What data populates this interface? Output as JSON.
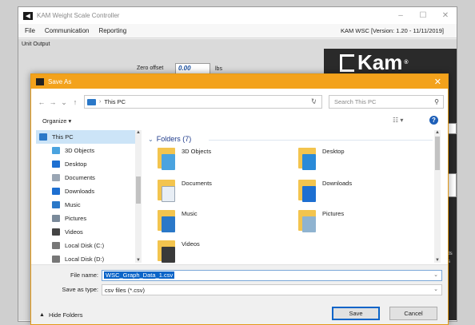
{
  "app": {
    "title": "KAM Weight Scale Controller",
    "menu": [
      "File",
      "Communication",
      "Reporting"
    ],
    "version": "KAM WSC [Version: 1.20 - 11/11/2019]",
    "unit_output_label": "Unit Output",
    "zero_offset_label": "Zero offset",
    "zero_offset_value": "0.00",
    "zero_offset_unit": "lbs",
    "brand": "Kam",
    "side_text_1": "nds",
    "side_text_2": "s"
  },
  "dialog": {
    "title": "Save As",
    "close_glyph": "✕",
    "address": "This PC",
    "search_placeholder": "Search This PC",
    "organize_label": "Organize ▾",
    "nav_items": [
      {
        "label": "This PC",
        "icon": "computer-icon",
        "color": "#2a78c8"
      },
      {
        "label": "3D Objects",
        "icon": "cube-icon",
        "color": "#4aa3df"
      },
      {
        "label": "Desktop",
        "icon": "desktop-icon",
        "color": "#1d6fd1"
      },
      {
        "label": "Documents",
        "icon": "document-icon",
        "color": "#9aa6b4"
      },
      {
        "label": "Downloads",
        "icon": "download-arrow-icon",
        "color": "#1d6fd1"
      },
      {
        "label": "Music",
        "icon": "music-note-icon",
        "color": "#2a78c8"
      },
      {
        "label": "Pictures",
        "icon": "picture-icon",
        "color": "#7a8a9a"
      },
      {
        "label": "Videos",
        "icon": "film-icon",
        "color": "#444"
      },
      {
        "label": "Local Disk (C:)",
        "icon": "drive-icon",
        "color": "#777"
      },
      {
        "label": "Local Disk (D:)",
        "icon": "drive-icon",
        "color": "#777"
      }
    ],
    "folders_heading": "Folders (7)",
    "folders": [
      {
        "label": "3D Objects",
        "icon": "3d-objects-folder-icon",
        "color": "#4aa3df"
      },
      {
        "label": "Desktop",
        "icon": "desktop-folder-icon",
        "color": "#2a8ad8"
      },
      {
        "label": "Documents",
        "icon": "documents-folder-icon",
        "color": "#e8eef5"
      },
      {
        "label": "Downloads",
        "icon": "downloads-folder-icon",
        "color": "#1d6fd1"
      },
      {
        "label": "Music",
        "icon": "music-folder-icon",
        "color": "#2a78c8"
      },
      {
        "label": "Pictures",
        "icon": "pictures-folder-icon",
        "color": "#8fb3d0"
      },
      {
        "label": "Videos",
        "icon": "videos-folder-icon",
        "color": "#3a3a3a"
      }
    ],
    "file_name_label": "File name:",
    "file_name_value": "WSC_Graph_Data_1.csv",
    "save_type_label": "Save as type:",
    "save_type_value": "csv files (*.csv)",
    "hide_folders_label": "Hide Folders",
    "save_button": "Save",
    "cancel_button": "Cancel"
  },
  "colors": {
    "dialog_titlebar": "#f3a21c",
    "selection": "#0a64c8",
    "nav_selected": "#cce4f7",
    "folder": "#f3c44e"
  }
}
